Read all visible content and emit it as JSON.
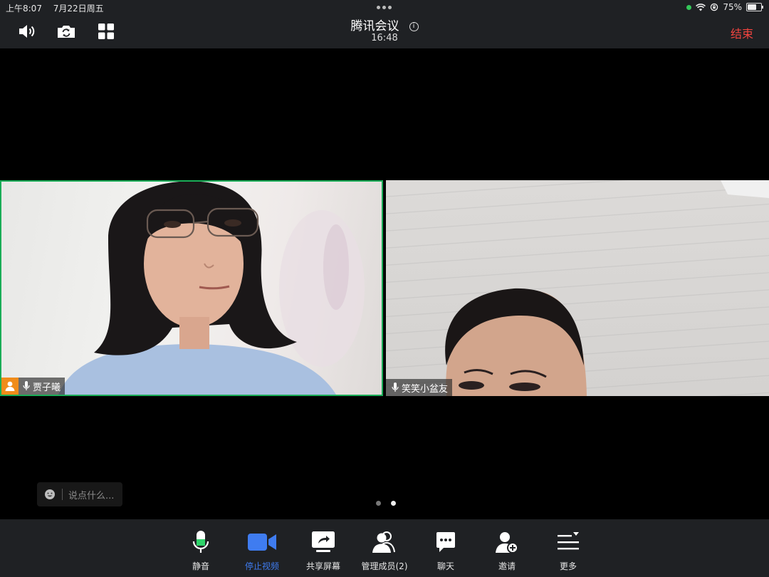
{
  "status_bar": {
    "time": "上午8:07",
    "date": "7月22日周五",
    "battery": "75%",
    "battery_level": 0.75
  },
  "header": {
    "title": "腾讯会议",
    "info_glyph": "i",
    "duration": "16:48",
    "end_label": "结束",
    "icons": [
      "speaker-icon",
      "switch-camera-icon",
      "grid-layout-icon"
    ]
  },
  "participants": [
    {
      "name": "贾子曦",
      "is_host": true,
      "speaking": true,
      "mic": "on"
    },
    {
      "name": "笑笑小盆友",
      "is_host": false,
      "speaking": false,
      "mic": "on"
    }
  ],
  "chat": {
    "placeholder": "说点什么..."
  },
  "pager": {
    "pages": 2,
    "current": 2
  },
  "toolbar": {
    "items": [
      {
        "label": "静音",
        "icon": "microphone-icon",
        "active": false
      },
      {
        "label": "停止视频",
        "icon": "video-camera-icon",
        "active": true
      },
      {
        "label": "共享屏幕",
        "icon": "share-screen-icon",
        "active": false
      },
      {
        "label": "管理成员(2)",
        "icon": "members-icon",
        "active": false
      },
      {
        "label": "聊天",
        "icon": "chat-icon",
        "active": false
      },
      {
        "label": "邀请",
        "icon": "invite-user-icon",
        "active": false
      },
      {
        "label": "更多",
        "icon": "more-menu-icon",
        "active": false
      }
    ]
  },
  "colors": {
    "bar_bg": "#1f2124",
    "accent_blue": "#3f7cf0",
    "end_red": "#f1443f",
    "speaking_border": "#1aad57",
    "mic_level_green": "#2fd36a",
    "host_badge": "#f08c1a"
  }
}
